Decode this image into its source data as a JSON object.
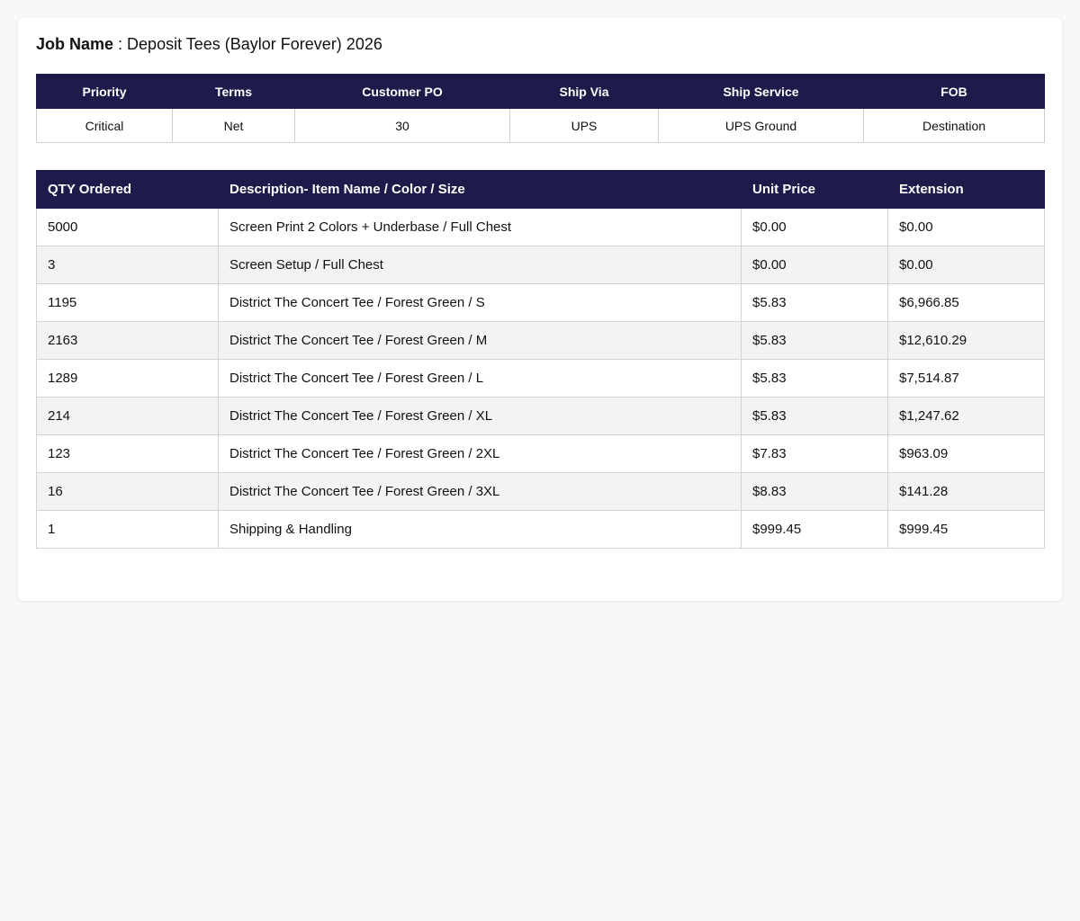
{
  "job": {
    "label": "Job Name",
    "separator": " : ",
    "value": "Deposit Tees (Baylor Forever) 2026"
  },
  "meta": {
    "headers": [
      "Priority",
      "Terms",
      "Customer PO",
      "Ship Via",
      "Ship Service",
      "FOB"
    ],
    "values": [
      "Critical",
      "Net",
      "30",
      "UPS",
      "UPS Ground",
      "Destination"
    ]
  },
  "items": {
    "headers": [
      "QTY Ordered",
      "Description- Item Name / Color / Size",
      "Unit Price",
      "Extension"
    ],
    "rows": [
      [
        "5000",
        "Screen Print 2 Colors + Underbase / Full Chest",
        "$0.00",
        "$0.00"
      ],
      [
        "3",
        "Screen Setup / Full Chest",
        "$0.00",
        "$0.00"
      ],
      [
        "1195",
        "District The Concert Tee / Forest Green / S",
        "$5.83",
        "$6,966.85"
      ],
      [
        "2163",
        "District The Concert Tee / Forest Green / M",
        "$5.83",
        "$12,610.29"
      ],
      [
        "1289",
        "District The Concert Tee / Forest Green / L",
        "$5.83",
        "$7,514.87"
      ],
      [
        "214",
        "District The Concert Tee / Forest Green / XL",
        "$5.83",
        "$1,247.62"
      ],
      [
        "123",
        "District The Concert Tee / Forest Green / 2XL",
        "$7.83",
        "$963.09"
      ],
      [
        "16",
        "District The Concert Tee / Forest Green / 3XL",
        "$8.83",
        "$141.28"
      ],
      [
        "1",
        "Shipping & Handling",
        "$999.45",
        "$999.45"
      ]
    ]
  },
  "colors": {
    "header_bg": "#1c1b4a",
    "header_text": "#ffffff",
    "row_alt_bg": "#f3f3f3"
  }
}
